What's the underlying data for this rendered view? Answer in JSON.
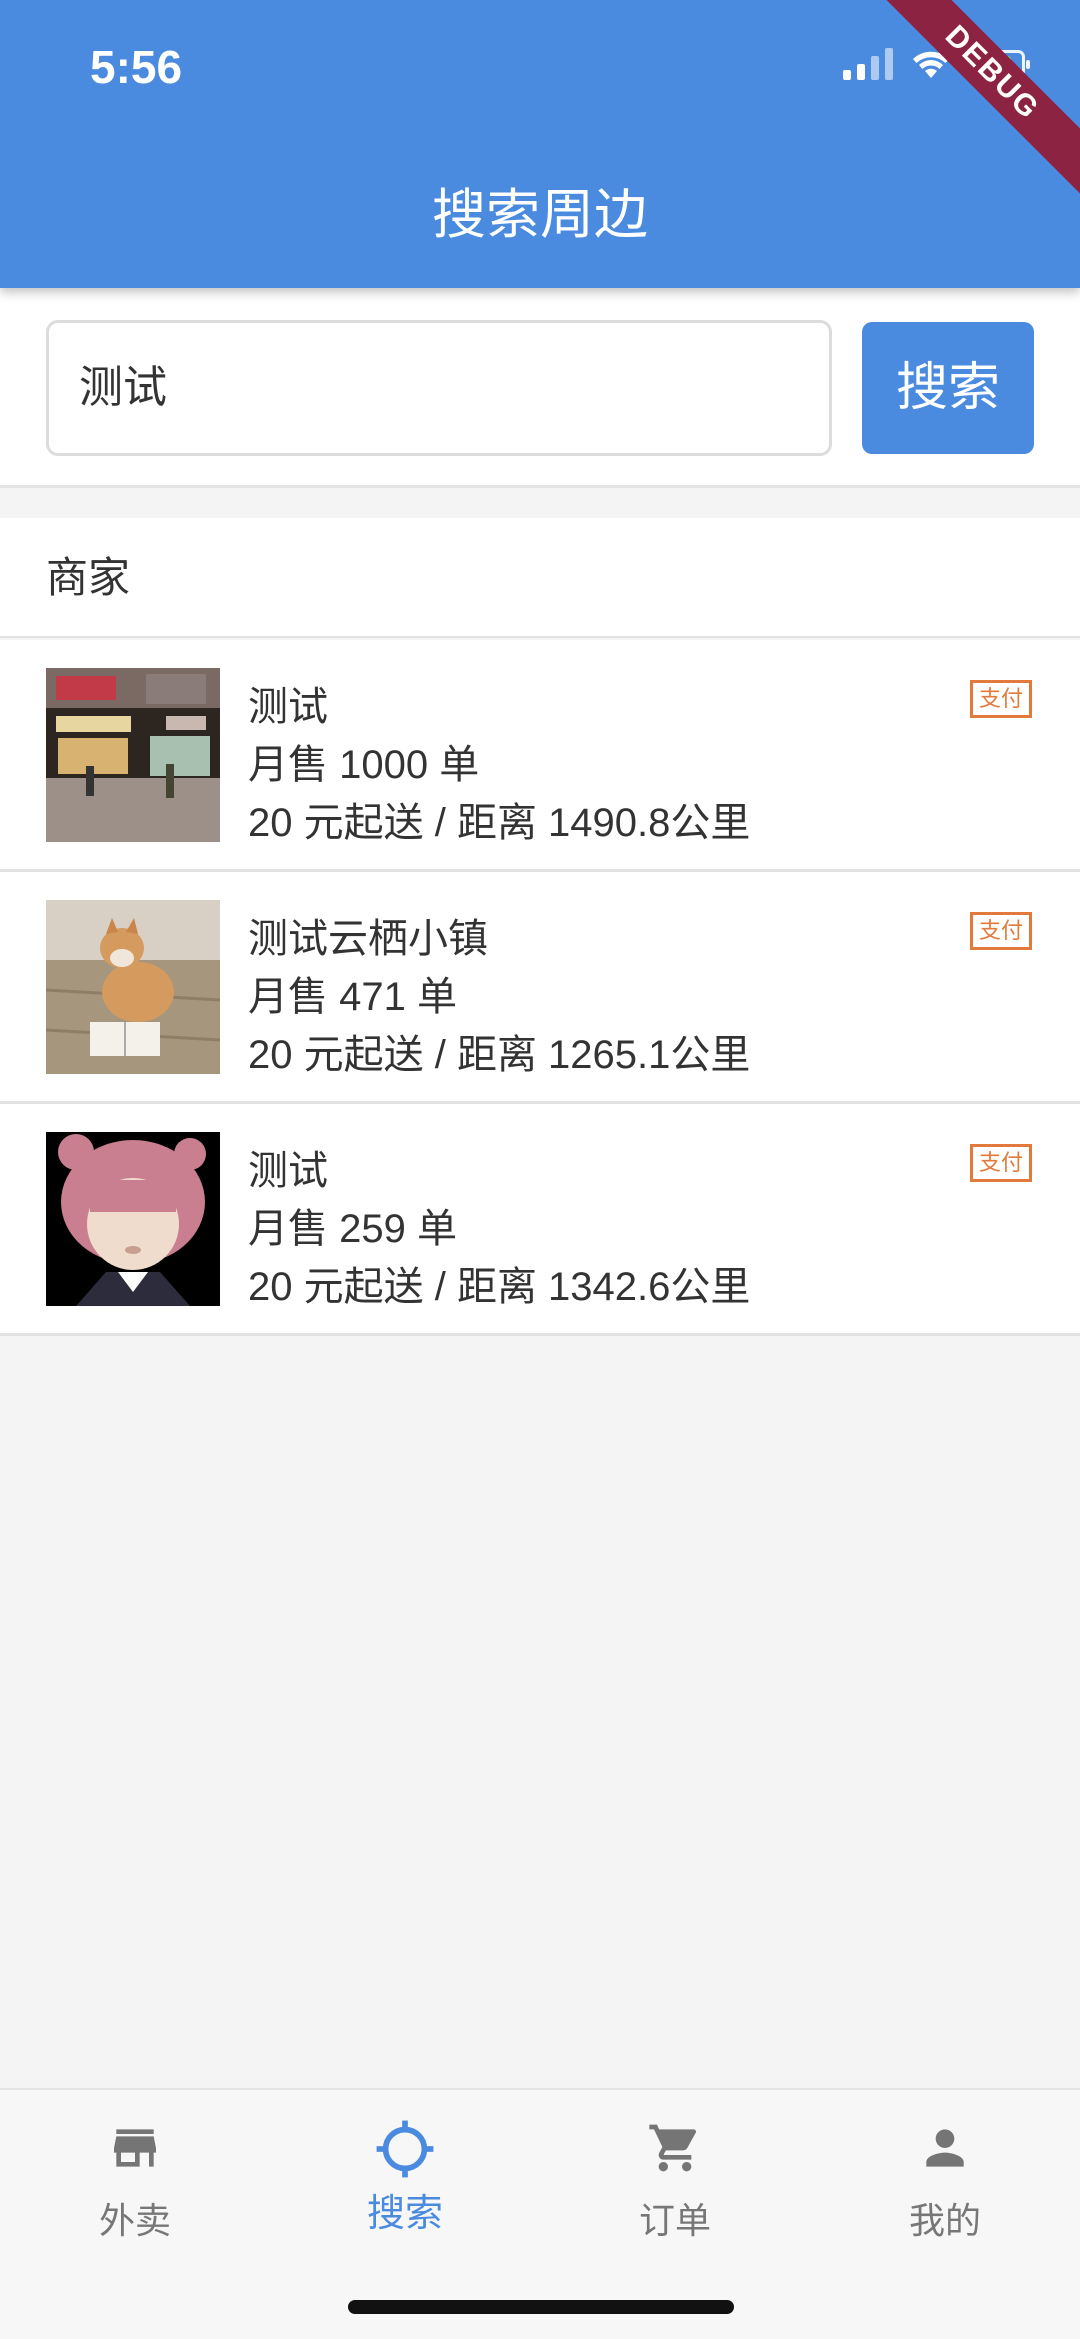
{
  "status_bar": {
    "time": "5:56",
    "debug_label": "DEBUG"
  },
  "header": {
    "title": "搜索周边"
  },
  "search": {
    "value": "测试",
    "button_label": "搜索"
  },
  "section": {
    "title": "商家"
  },
  "merchants": [
    {
      "name": "测试",
      "sales": "月售 1000 单",
      "info": "20 元起送 / 距离 1490.8公里",
      "badge": "支付"
    },
    {
      "name": "测试云栖小镇",
      "sales": "月售 471 单",
      "info": "20 元起送 / 距离 1265.1公里",
      "badge": "支付"
    },
    {
      "name": "测试",
      "sales": "月售 259 单",
      "info": "20 元起送 / 距离 1342.6公里",
      "badge": "支付"
    }
  ],
  "bottom_nav": {
    "items": [
      {
        "label": "外卖",
        "icon": "store-icon",
        "active": false
      },
      {
        "label": "搜索",
        "icon": "gps-target-icon",
        "active": true
      },
      {
        "label": "订单",
        "icon": "cart-icon",
        "active": false
      },
      {
        "label": "我的",
        "icon": "person-icon",
        "active": false
      }
    ]
  },
  "colors": {
    "primary": "#4a8be0",
    "badge": "#e27a3e",
    "debug": "#8c2343"
  }
}
